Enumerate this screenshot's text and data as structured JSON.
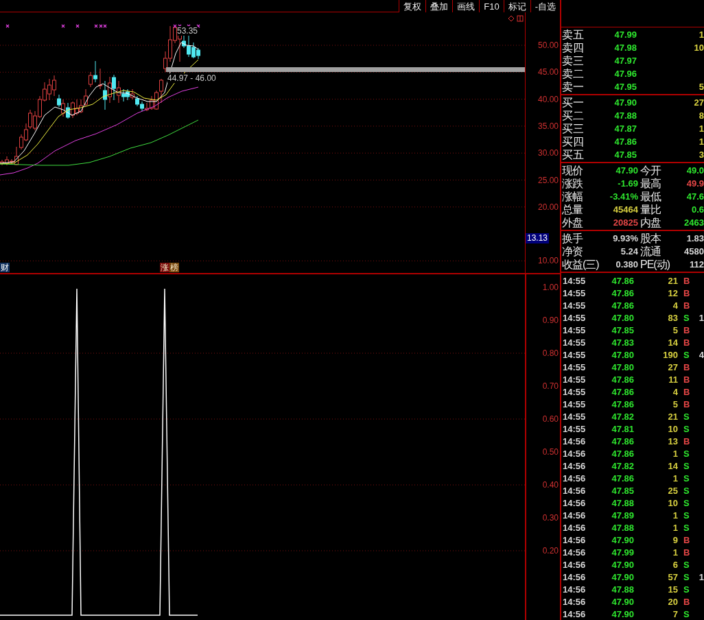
{
  "toolbar": {
    "buttons": [
      "复权",
      "叠加",
      "画线",
      "F10",
      "标记",
      "-自选"
    ]
  },
  "price_chart": {
    "axis_labels": [
      "50.00",
      "45.00",
      "40.00",
      "35.00",
      "30.00",
      "25.00",
      "20.00",
      "10.00"
    ],
    "current_price_tag": "13.13",
    "high_label": "53.35",
    "range_label": "44.97 - 46.00",
    "markers": [
      {
        "text": "财",
        "color": "#12305e"
      },
      {
        "text": "涨",
        "color": "#7a0c0c"
      },
      {
        "text": "榜",
        "color": "#7a4a10"
      }
    ]
  },
  "indicator_chart": {
    "axis_labels": [
      "1.00",
      "0.90",
      "0.80",
      "0.70",
      "0.60",
      "0.50",
      "0.40",
      "0.30",
      "0.20"
    ]
  },
  "order_book": {
    "asks": [
      {
        "label": "卖五",
        "price": "47.99",
        "volume": "1"
      },
      {
        "label": "卖四",
        "price": "47.98",
        "volume": "10"
      },
      {
        "label": "卖三",
        "price": "47.97"
      },
      {
        "label": "卖二",
        "price": "47.96"
      },
      {
        "label": "卖一",
        "price": "47.95",
        "volume": "5"
      }
    ],
    "bids": [
      {
        "label": "买一",
        "price": "47.90",
        "volume": "27"
      },
      {
        "label": "买二",
        "price": "47.88",
        "volume": "8"
      },
      {
        "label": "买三",
        "price": "47.87",
        "volume": "1"
      },
      {
        "label": "买四",
        "price": "47.86",
        "volume": "1"
      },
      {
        "label": "买五",
        "price": "47.85",
        "volume": "3"
      }
    ]
  },
  "quote": [
    {
      "left": {
        "label": "现价",
        "value": "47.90",
        "color": "#2ee62e"
      },
      "right": {
        "label": "今开",
        "value": "49.0",
        "color": "#2ee62e"
      }
    },
    {
      "left": {
        "label": "涨跌",
        "value": "-1.69",
        "color": "#2ee62e"
      },
      "right": {
        "label": "最高",
        "value": "49.9",
        "color": "#e64646"
      }
    },
    {
      "left": {
        "label": "涨幅",
        "value": "-3.41%",
        "color": "#2ee62e"
      },
      "right": {
        "label": "最低",
        "value": "47.6",
        "color": "#2ee62e"
      }
    },
    {
      "left": {
        "label": "总量",
        "value": "45464",
        "color": "#d8d040"
      },
      "right": {
        "label": "量比",
        "value": "0.6",
        "color": "#2ee62e"
      }
    },
    {
      "left": {
        "label": "外盘",
        "value": "20825",
        "color": "#e64646"
      },
      "right": {
        "label": "内盘",
        "value": "2463",
        "color": "#2ee62e"
      }
    }
  ],
  "fundamentals": [
    {
      "left": {
        "label": "换手",
        "value": "9.93%"
      },
      "right": {
        "label": "股本",
        "value": "1.83"
      }
    },
    {
      "left": {
        "label": "净资",
        "value": "5.24"
      },
      "right": {
        "label": "流通",
        "value": "4580"
      }
    },
    {
      "left": {
        "label": "收益(三)",
        "value": "0.380"
      },
      "right": {
        "label": "PE(动)",
        "value": "112"
      }
    }
  ],
  "trades": [
    {
      "time": "14:55",
      "price": "47.86",
      "volume": "21",
      "side": "B",
      "kind": "buy"
    },
    {
      "time": "14:55",
      "price": "47.86",
      "volume": "12",
      "side": "B",
      "kind": "buy"
    },
    {
      "time": "14:55",
      "price": "47.86",
      "volume": "4",
      "side": "B",
      "kind": "buy"
    },
    {
      "time": "14:55",
      "price": "47.80",
      "volume": "83",
      "side": "S",
      "kind": "sell",
      "column_5": "1"
    },
    {
      "time": "14:55",
      "price": "47.85",
      "volume": "5",
      "side": "B",
      "kind": "buy"
    },
    {
      "time": "14:55",
      "price": "47.83",
      "volume": "14",
      "side": "B",
      "kind": "buy"
    },
    {
      "time": "14:55",
      "price": "47.80",
      "volume": "190",
      "side": "S",
      "kind": "sell",
      "column_5": "4"
    },
    {
      "time": "14:55",
      "price": "47.80",
      "volume": "27",
      "side": "B",
      "kind": "buy"
    },
    {
      "time": "14:55",
      "price": "47.86",
      "volume": "11",
      "side": "B",
      "kind": "buy"
    },
    {
      "time": "14:55",
      "price": "47.86",
      "volume": "4",
      "side": "B",
      "kind": "buy"
    },
    {
      "time": "14:55",
      "price": "47.86",
      "volume": "5",
      "side": "B",
      "kind": "buy"
    },
    {
      "time": "14:55",
      "price": "47.82",
      "volume": "21",
      "side": "S",
      "kind": "sell"
    },
    {
      "time": "14:55",
      "price": "47.81",
      "volume": "10",
      "side": "S",
      "kind": "sell"
    },
    {
      "time": "14:56",
      "price": "47.86",
      "volume": "13",
      "side": "B",
      "kind": "buy"
    },
    {
      "time": "14:56",
      "price": "47.86",
      "volume": "1",
      "side": "S",
      "kind": "sell"
    },
    {
      "time": "14:56",
      "price": "47.82",
      "volume": "14",
      "side": "S",
      "kind": "sell"
    },
    {
      "time": "14:56",
      "price": "47.86",
      "volume": "1",
      "side": "S",
      "kind": "sell"
    },
    {
      "time": "14:56",
      "price": "47.85",
      "volume": "25",
      "side": "S",
      "kind": "sell"
    },
    {
      "time": "14:56",
      "price": "47.88",
      "volume": "10",
      "side": "S",
      "kind": "sell"
    },
    {
      "time": "14:56",
      "price": "47.89",
      "volume": "1",
      "side": "S",
      "kind": "sell"
    },
    {
      "time": "14:56",
      "price": "47.88",
      "volume": "1",
      "side": "S",
      "kind": "sell"
    },
    {
      "time": "14:56",
      "price": "47.90",
      "volume": "9",
      "side": "B",
      "kind": "buy"
    },
    {
      "time": "14:56",
      "price": "47.99",
      "volume": "1",
      "side": "B",
      "kind": "buy"
    },
    {
      "time": "14:56",
      "price": "47.90",
      "volume": "6",
      "side": "S",
      "kind": "sell"
    },
    {
      "time": "14:56",
      "price": "47.90",
      "volume": "57",
      "side": "S",
      "kind": "sell",
      "column_5": "1"
    },
    {
      "time": "14:56",
      "price": "47.88",
      "volume": "15",
      "side": "S",
      "kind": "sell"
    },
    {
      "time": "14:56",
      "price": "47.90",
      "volume": "20",
      "side": "B",
      "kind": "buy"
    },
    {
      "time": "14:56",
      "price": "47.90",
      "volume": "7",
      "side": "S",
      "kind": "sell"
    }
  ]
}
